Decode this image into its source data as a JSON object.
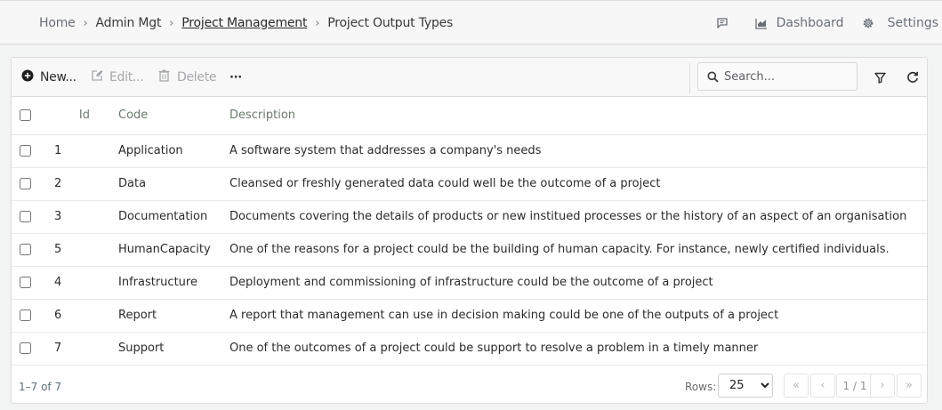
{
  "breadcrumb": {
    "home": "Home",
    "admin": "Admin Mgt",
    "project_mgmt": "Project Management",
    "current": "Project Output Types"
  },
  "topnav": {
    "chat_icon": "message-square-icon",
    "dashboard_label": "Dashboard",
    "dashboard_icon": "chart-area-icon",
    "settings_label": "Settings",
    "settings_icon": "gear-icon"
  },
  "toolbar": {
    "new_label": "New...",
    "edit_label": "Edit...",
    "delete_label": "Delete",
    "more_label": "···",
    "search_placeholder": "Search...",
    "filter_icon": "filter-icon",
    "refresh_icon": "refresh-icon"
  },
  "table": {
    "headers": {
      "id": "Id",
      "code": "Code",
      "description": "Description"
    },
    "rows": [
      {
        "id": "1",
        "code": "Application",
        "description": "A software system that addresses a company's needs"
      },
      {
        "id": "2",
        "code": "Data",
        "description": "Cleansed or freshly generated data could well be the outcome of a project"
      },
      {
        "id": "3",
        "code": "Documentation",
        "description": "Documents covering the details of products or new institued processes or the history of an aspect of an organisation"
      },
      {
        "id": "5",
        "code": "HumanCapacity",
        "description": "One of the reasons for a project could be the building of human capacity. For instance, newly certified individuals."
      },
      {
        "id": "4",
        "code": "Infrastructure",
        "description": "Deployment and commissioning of infrastructure could be the outcome of a project"
      },
      {
        "id": "6",
        "code": "Report",
        "description": "A report that management can use in decision making could be one of the outputs of a project"
      },
      {
        "id": "7",
        "code": "Support",
        "description": "One of the outcomes of a project could be support to resolve a problem in a timely manner"
      }
    ]
  },
  "footer": {
    "count": "1–7 of 7",
    "rows_label": "Rows:",
    "rows_value": "25",
    "first": "«",
    "prev": "‹",
    "page_info": "1 / 1",
    "next": "›",
    "last": "»"
  },
  "colors": {
    "header_text": "#6b7a6b",
    "disabled": "#a6a8ab",
    "bg": "#f2f3f3"
  }
}
